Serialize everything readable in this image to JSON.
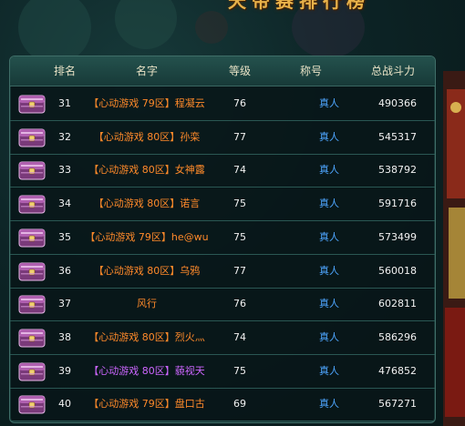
{
  "banner_title": "天帝赛排行榜",
  "columns": {
    "rank": "排名",
    "name": "名字",
    "level": "等级",
    "title": "称号",
    "power": "总战斗力"
  },
  "rows": [
    {
      "rank": "31",
      "name": "【心动游戏 79区】程凝云",
      "level": "76",
      "title": "真人",
      "power": "490366",
      "name_color": "orange"
    },
    {
      "rank": "32",
      "name": "【心动游戏 80区】孙栾",
      "level": "77",
      "title": "真人",
      "power": "545317",
      "name_color": "orange"
    },
    {
      "rank": "33",
      "name": "【心动游戏 80区】女神露",
      "level": "74",
      "title": "真人",
      "power": "538792",
      "name_color": "orange"
    },
    {
      "rank": "34",
      "name": "【心动游戏 80区】诺言",
      "level": "75",
      "title": "真人",
      "power": "591716",
      "name_color": "orange"
    },
    {
      "rank": "35",
      "name": "【心动游戏 79区】he@wu",
      "level": "75",
      "title": "真人",
      "power": "573499",
      "name_color": "orange"
    },
    {
      "rank": "36",
      "name": "【心动游戏 80区】乌鸦",
      "level": "77",
      "title": "真人",
      "power": "560018",
      "name_color": "orange"
    },
    {
      "rank": "37",
      "name": "风行",
      "level": "76",
      "title": "真人",
      "power": "602811",
      "name_color": "orange"
    },
    {
      "rank": "38",
      "name": "【心动游戏 80区】烈火灬",
      "level": "74",
      "title": "真人",
      "power": "586296",
      "name_color": "orange"
    },
    {
      "rank": "39",
      "name": "【心动游戏 80区】藐视天",
      "level": "75",
      "title": "真人",
      "power": "476852",
      "name_color": "purple"
    },
    {
      "rank": "40",
      "name": "【心动游戏 79区】盘口古",
      "level": "69",
      "title": "真人",
      "power": "567271",
      "name_color": "orange"
    }
  ],
  "icons": {
    "row_icon": "treasure-chest-icon"
  },
  "colors": {
    "name_orange": "#ff8a2a",
    "name_purple": "#cc66ff",
    "title_blue": "#4ea6ff",
    "banner_gold": "#e8b24a"
  }
}
